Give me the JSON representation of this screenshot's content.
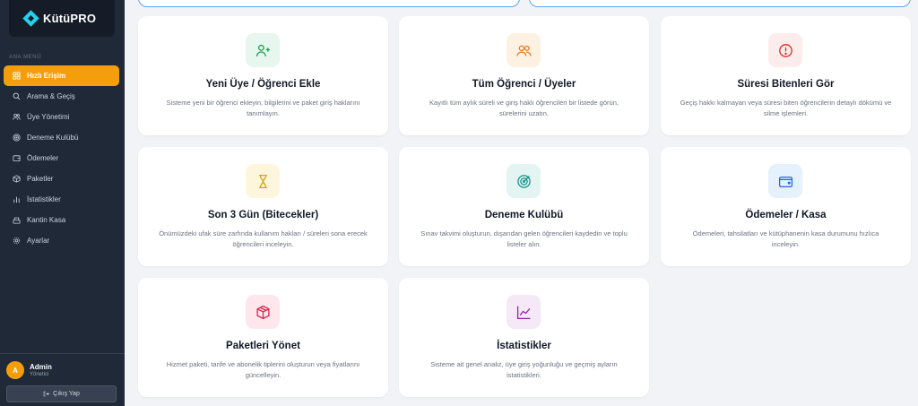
{
  "app": {
    "logo_text": "KütüPRO"
  },
  "sidebar": {
    "section_label": "ANA MENÜ",
    "items": [
      {
        "label": "Hızlı Erişim",
        "icon": "grid-icon",
        "active": true
      },
      {
        "label": "Arama & Geçiş",
        "icon": "search-icon",
        "active": false
      },
      {
        "label": "Üye Yönetimi",
        "icon": "users-icon",
        "active": false
      },
      {
        "label": "Deneme Kulübü",
        "icon": "target-icon",
        "active": false
      },
      {
        "label": "Ödemeler",
        "icon": "wallet-icon",
        "active": false
      },
      {
        "label": "Paketler",
        "icon": "package-icon",
        "active": false
      },
      {
        "label": "İstatistikler",
        "icon": "bar-chart-icon",
        "active": false
      },
      {
        "label": "Kantin Kasa",
        "icon": "register-icon",
        "active": false
      },
      {
        "label": "Ayarlar",
        "icon": "gear-icon",
        "active": false
      }
    ],
    "user": {
      "initial": "A",
      "name": "Admin",
      "role": "Yönetici"
    },
    "logout_label": "Çıkış Yap"
  },
  "cards": [
    {
      "title": "Yeni Üye / Öğrenci Ekle",
      "desc": "Sisteme yeni bir öğrenci ekleyin, bilgilerini ve paket giriş haklarını tanımlayın.",
      "icon": "user-plus-icon",
      "bg": "#e7f6ee",
      "color": "#16a34a"
    },
    {
      "title": "Tüm Öğrenci / Üyeler",
      "desc": "Kayıtlı tüm aylık süreli ve giriş haklı öğrencileri bir listede görün, sürelerini uzatın.",
      "icon": "users-icon",
      "bg": "#fdf1e2",
      "color": "#ea7a1a"
    },
    {
      "title": "Süresi Bitenleri Gör",
      "desc": "Geçiş hakkı kalmayan veya süresi biten öğrencilerin detaylı dökümü ve silme işlemleri.",
      "icon": "alert-circle-icon",
      "bg": "#fdecec",
      "color": "#dc2626"
    },
    {
      "title": "Son 3 Gün (Bitecekler)",
      "desc": "Önümüzdeki ufak süre zarfında kullanım hakları / süreleri sona erecek öğrencileri inceleyin.",
      "icon": "hourglass-icon",
      "bg": "#fdf6dc",
      "color": "#d4a017"
    },
    {
      "title": "Deneme Kulübü",
      "desc": "Sınav takvimi oluşturun, dışarıdan gelen öğrencileri kaydedin ve toplu listeler alın.",
      "icon": "target-icon",
      "bg": "#e3f4f3",
      "color": "#0f9488"
    },
    {
      "title": "Ödemeler / Kasa",
      "desc": "Ödemeleri, tahsilatları ve kütüphanenin kasa durumunu hızlıca inceleyin.",
      "icon": "wallet-icon",
      "bg": "#e5f1fd",
      "color": "#2563eb"
    },
    {
      "title": "Paketleri Yönet",
      "desc": "Hizmet paketi, tarife ve abonelik tiplerini oluşturun veya fiyatlarını güncelleyin.",
      "icon": "package-icon",
      "bg": "#fde7ec",
      "color": "#e11d48"
    },
    {
      "title": "İstatistikler",
      "desc": "Sisteme ait genel analiz, üye giriş yoğunluğu ve geçmiş ayların istatistikleri.",
      "icon": "trend-icon",
      "bg": "#f5e8f7",
      "color": "#a21caf"
    }
  ]
}
